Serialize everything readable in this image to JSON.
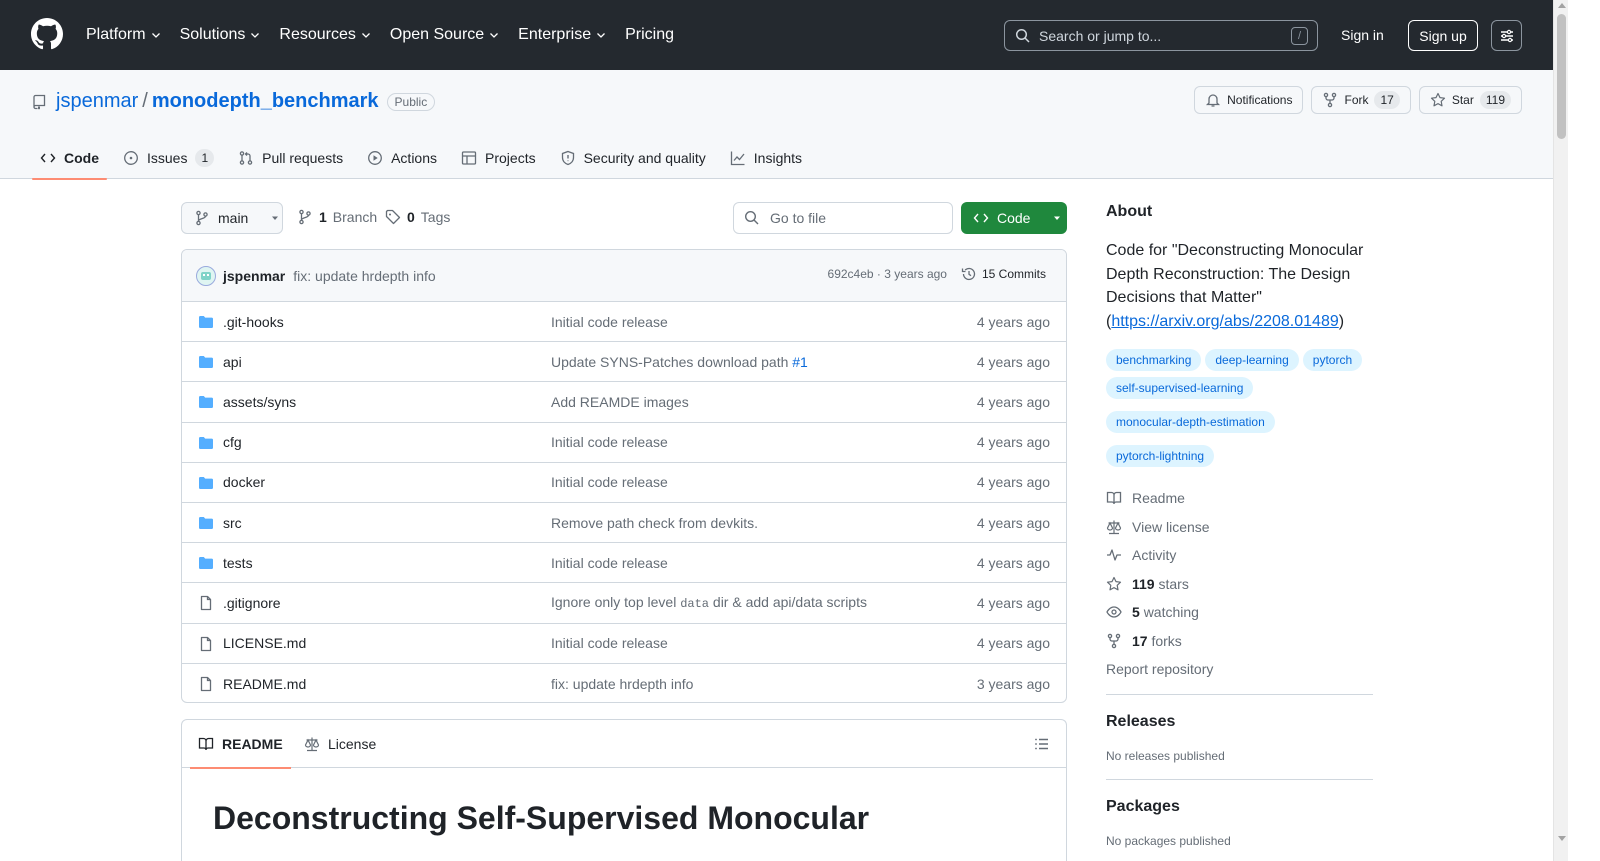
{
  "header": {
    "nav": [
      "Platform",
      "Solutions",
      "Resources",
      "Open Source",
      "Enterprise",
      "Pricing"
    ],
    "search_placeholder": "Search or jump to...",
    "search_key": "/",
    "sign_in": "Sign in",
    "sign_up": "Sign up"
  },
  "repo": {
    "owner": "jspenmar",
    "separator": "/",
    "name": "monodepth_benchmark",
    "visibility": "Public",
    "notifications_label": "Notifications",
    "fork_label": "Fork",
    "fork_count": "17",
    "star_label": "Star",
    "star_count": "119"
  },
  "repo_nav": {
    "code": "Code",
    "issues": "Issues",
    "issues_count": "1",
    "pulls": "Pull requests",
    "actions": "Actions",
    "projects": "Projects",
    "security": "Security and quality",
    "insights": "Insights"
  },
  "toolbar": {
    "branch": "main",
    "branch_count": "1",
    "branch_label": "Branch",
    "tag_count": "0",
    "tag_label": "Tags",
    "goto_placeholder": "Go to file",
    "code_button": "Code"
  },
  "latest_commit": {
    "author": "jspenmar",
    "message": "fix: update hrdepth info",
    "hash": "692c4eb",
    "dot": "·",
    "time": "3 years ago",
    "commits": "15 Commits"
  },
  "files": [
    {
      "type": "dir",
      "name": ".git-hooks",
      "message": "Initial code release",
      "time": "4 years ago"
    },
    {
      "type": "dir",
      "name": "api",
      "message": "Update SYNS-Patches download path",
      "link": "#1",
      "time": "4 years ago"
    },
    {
      "type": "dir",
      "name": "assets/syns",
      "message": "Add REAMDE images",
      "time": "4 years ago"
    },
    {
      "type": "dir",
      "name": "cfg",
      "message": "Initial code release",
      "time": "4 years ago"
    },
    {
      "type": "dir",
      "name": "docker",
      "message": "Initial code release",
      "time": "4 years ago"
    },
    {
      "type": "dir",
      "name": "src",
      "message": "Remove path check from devkits.",
      "time": "4 years ago"
    },
    {
      "type": "dir",
      "name": "tests",
      "message": "Initial code release",
      "time": "4 years ago"
    },
    {
      "type": "file",
      "name": ".gitignore",
      "message_pre": "Ignore only top level ",
      "message_code": "data",
      "message_post": " dir & add api/data scripts",
      "time": "4 years ago"
    },
    {
      "type": "file",
      "name": "LICENSE.md",
      "message": "Initial code release",
      "time": "4 years ago"
    },
    {
      "type": "file",
      "name": "README.md",
      "message": "fix: update hrdepth info",
      "time": "3 years ago"
    }
  ],
  "readme": {
    "tab_readme": "README",
    "tab_license": "License",
    "heading": "Deconstructing Self-Supervised Monocular"
  },
  "about": {
    "title": "About",
    "desc_pre": "Code for \"Deconstructing Monocular Depth Reconstruction: The Design Decisions that Matter\" (",
    "desc_link": "https://arxiv.org/abs/2208.01489",
    "desc_post": ")",
    "topics": [
      "benchmarking",
      "deep-learning",
      "pytorch",
      "self-supervised-learning",
      "monocular-depth-estimation",
      "pytorch-lightning"
    ],
    "readme": "Readme",
    "license": "View license",
    "activity": "Activity",
    "stars_count": "119",
    "stars_label": "stars",
    "watching_count": "5",
    "watching_label": "watching",
    "forks_count": "17",
    "forks_label": "forks",
    "report": "Report repository"
  },
  "releases": {
    "title": "Releases",
    "none": "No releases published"
  },
  "packages": {
    "title": "Packages",
    "none": "No packages published"
  }
}
